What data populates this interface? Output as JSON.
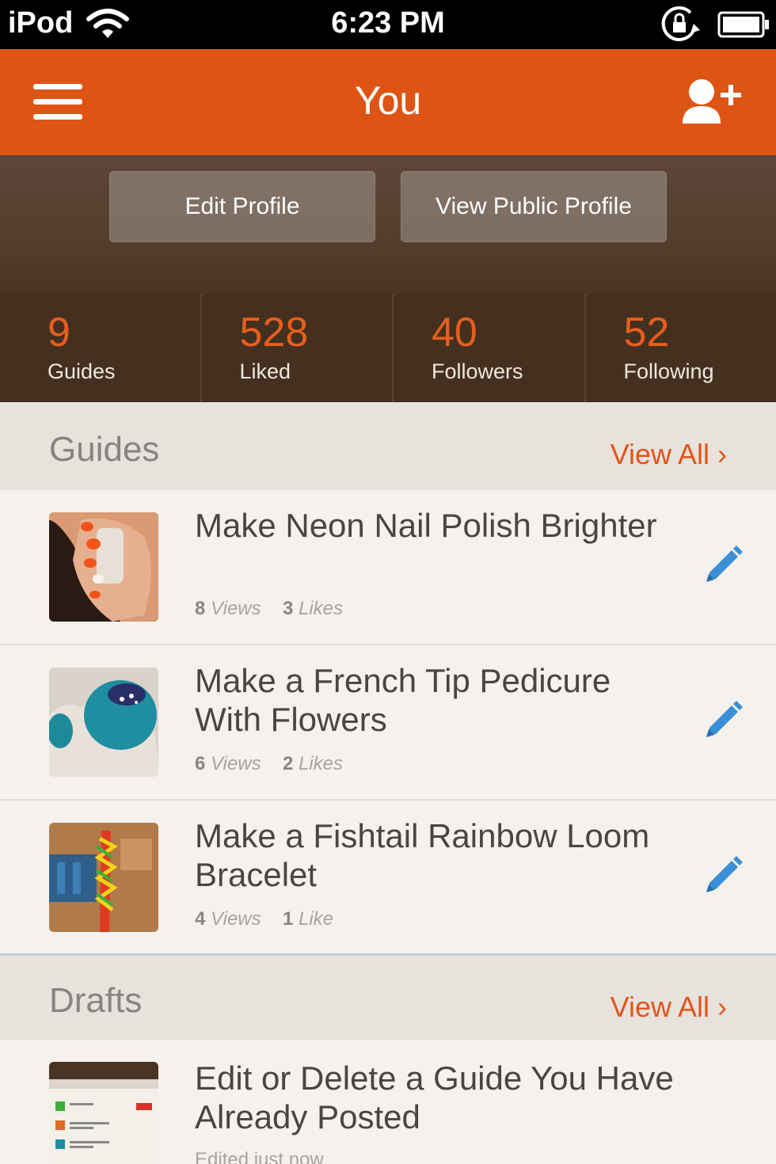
{
  "status_bar": {
    "carrier": "iPod",
    "time": "6:23 PM",
    "icons": [
      "wifi-icon",
      "rotation-lock-icon",
      "battery-icon"
    ]
  },
  "nav": {
    "title": "You",
    "left_icon": "hamburger-menu-icon",
    "right_icon": "add-user-icon"
  },
  "profile_buttons": {
    "edit": "Edit Profile",
    "view_public": "View Public Profile"
  },
  "stats": [
    {
      "value": "9",
      "label": "Guides"
    },
    {
      "value": "528",
      "label": "Liked"
    },
    {
      "value": "40",
      "label": "Followers"
    },
    {
      "value": "52",
      "label": "Following"
    }
  ],
  "guides_section": {
    "title": "Guides",
    "view_all": "View All ›",
    "items": [
      {
        "title": "Make Neon Nail Polish Brighter",
        "views_num": "8",
        "views_label": "Views",
        "likes_num": "3",
        "likes_label": "Likes"
      },
      {
        "title": "Make a French Tip Pedicure With Flowers",
        "views_num": "6",
        "views_label": "Views",
        "likes_num": "2",
        "likes_label": "Likes"
      },
      {
        "title": "Make a Fishtail Rainbow Loom Bracelet",
        "views_num": "4",
        "views_label": "Views",
        "likes_num": "1",
        "likes_label": "Like"
      }
    ]
  },
  "drafts_section": {
    "title": "Drafts",
    "view_all": "View All ›",
    "items": [
      {
        "title": "Edit or Delete a Guide You Have Already Posted",
        "meta": "Edited just now"
      }
    ]
  },
  "colors": {
    "accent": "#dd5414",
    "stat_number": "#e65f1d",
    "edit_pencil": "#3a8fd6"
  }
}
